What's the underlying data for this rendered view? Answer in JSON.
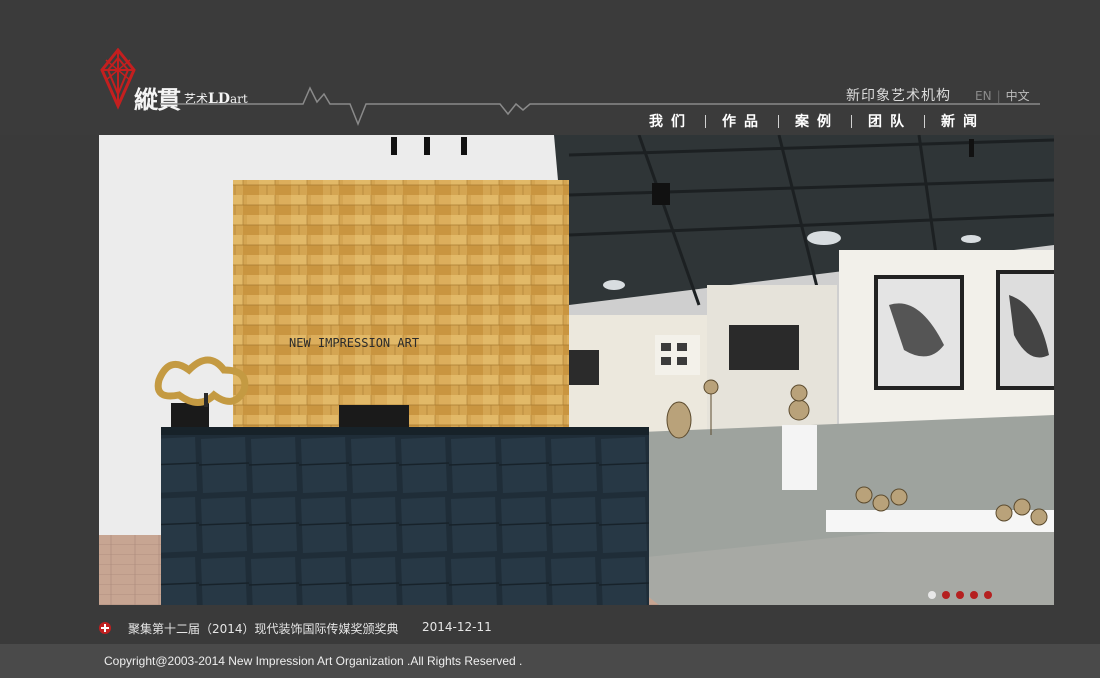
{
  "brand": {
    "name_cn": "縱貫",
    "name_sub": "艺术",
    "name_ld": "LD",
    "name_art": "art",
    "tagline": "新印象艺术机构"
  },
  "lang": {
    "en": "EN",
    "zh": "中文"
  },
  "nav": [
    {
      "label": "我们"
    },
    {
      "label": "作品"
    },
    {
      "label": "案例"
    },
    {
      "label": "团队"
    },
    {
      "label": "新闻"
    }
  ],
  "hero": {
    "wall_text": "NEW IMPRESSION ART",
    "slide_count": 5,
    "active_slide": 1
  },
  "news": {
    "title": "聚集第十二届（2014）现代装饰国际传媒奖颁奖典",
    "date": "2014-12-11"
  },
  "footer": {
    "copyright": "Copyright@2003-2014 New Impression Art Organization .All Rights Reserved ."
  },
  "colors": {
    "background": "#3a3a3a",
    "accent": "#c02020",
    "footer": "#4a4a4a"
  }
}
